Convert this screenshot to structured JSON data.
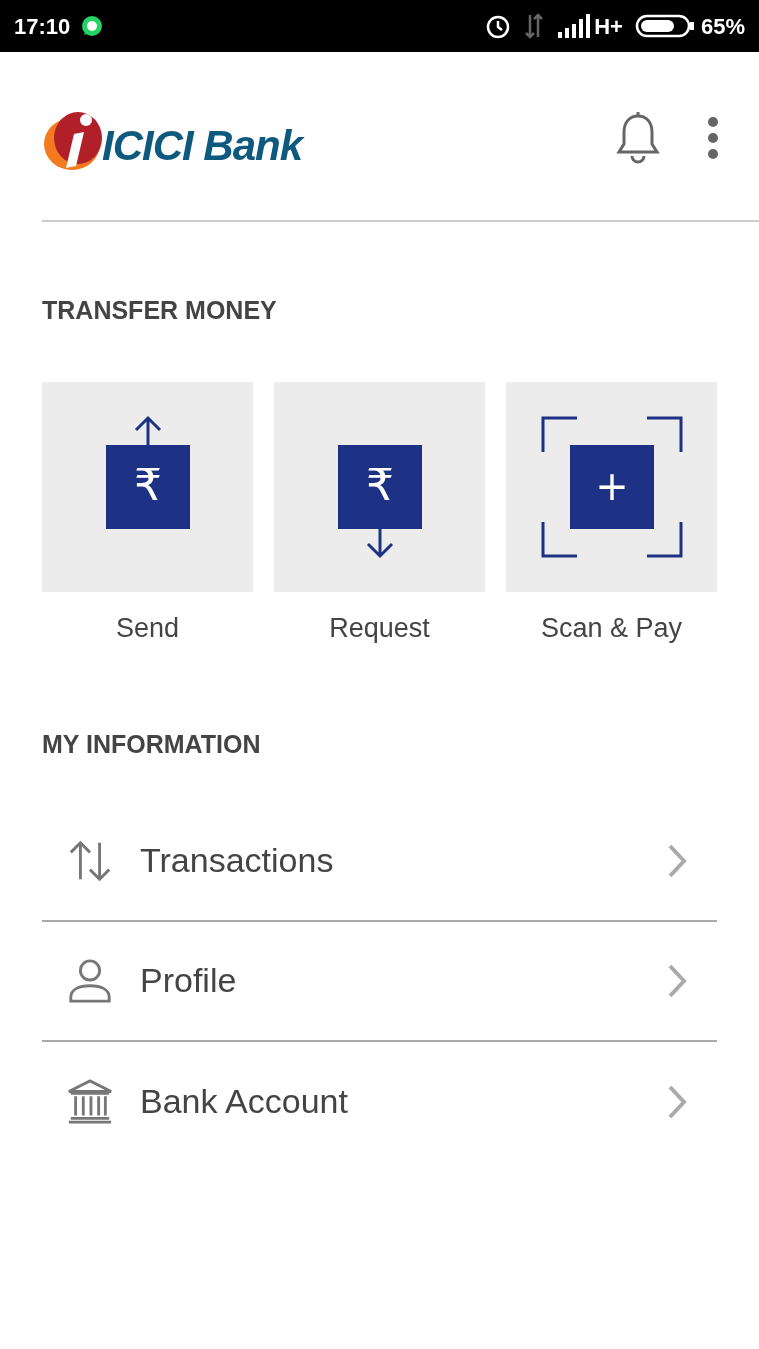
{
  "status_bar": {
    "time": "17:10",
    "network": "H+",
    "battery": "65%"
  },
  "header": {
    "brand": "ICICI Bank"
  },
  "transfer": {
    "title": "TRANSFER MONEY",
    "actions": [
      {
        "kind": "send",
        "label": "Send",
        "symbol": "₹"
      },
      {
        "kind": "request",
        "label": "Request",
        "symbol": "₹"
      },
      {
        "kind": "scan",
        "label": "Scan & Pay",
        "symbol": "+"
      }
    ]
  },
  "info": {
    "title": "MY INFORMATION",
    "items": [
      {
        "kind": "transactions",
        "label": "Transactions"
      },
      {
        "kind": "profile",
        "label": "Profile"
      },
      {
        "kind": "bank",
        "label": "Bank Account"
      }
    ]
  }
}
